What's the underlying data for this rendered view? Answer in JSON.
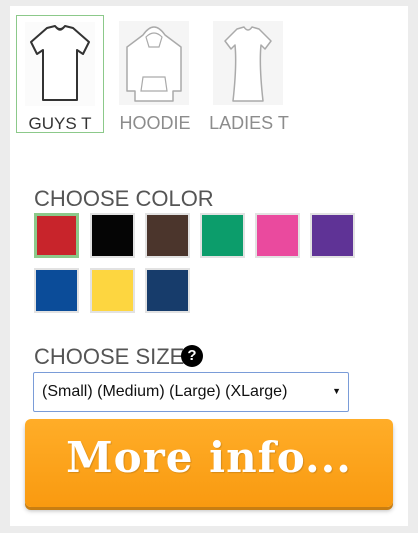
{
  "products": [
    {
      "label": "GUYS T",
      "icon": "tshirt-icon",
      "selected": true
    },
    {
      "label": "HOODIE",
      "icon": "hoodie-icon",
      "selected": false
    },
    {
      "label": "LADIES T",
      "icon": "ladies-tshirt-icon",
      "selected": false
    }
  ],
  "color_section": {
    "title": "CHOOSE COLOR",
    "swatches": [
      {
        "name": "red",
        "hex": "#c8242b",
        "selected": true
      },
      {
        "name": "black",
        "hex": "#050505"
      },
      {
        "name": "brown",
        "hex": "#4b352c"
      },
      {
        "name": "green",
        "hex": "#0c9d6b"
      },
      {
        "name": "pink",
        "hex": "#ea4a9e"
      },
      {
        "name": "purple",
        "hex": "#5f3396"
      },
      {
        "name": "royal-blue",
        "hex": "#0b4c99"
      },
      {
        "name": "yellow",
        "hex": "#fdd640"
      },
      {
        "name": "navy",
        "hex": "#173c6b"
      }
    ]
  },
  "size_section": {
    "title": "CHOOSE SIZE",
    "help_icon": "question-circle-icon",
    "selected_value": "(Small) (Medium) (Large) (XLarge)"
  },
  "more_info_button": {
    "label": "More info..."
  },
  "colors": {
    "accent_orange": "#fca41c",
    "selected_border": "#8cc98a"
  }
}
